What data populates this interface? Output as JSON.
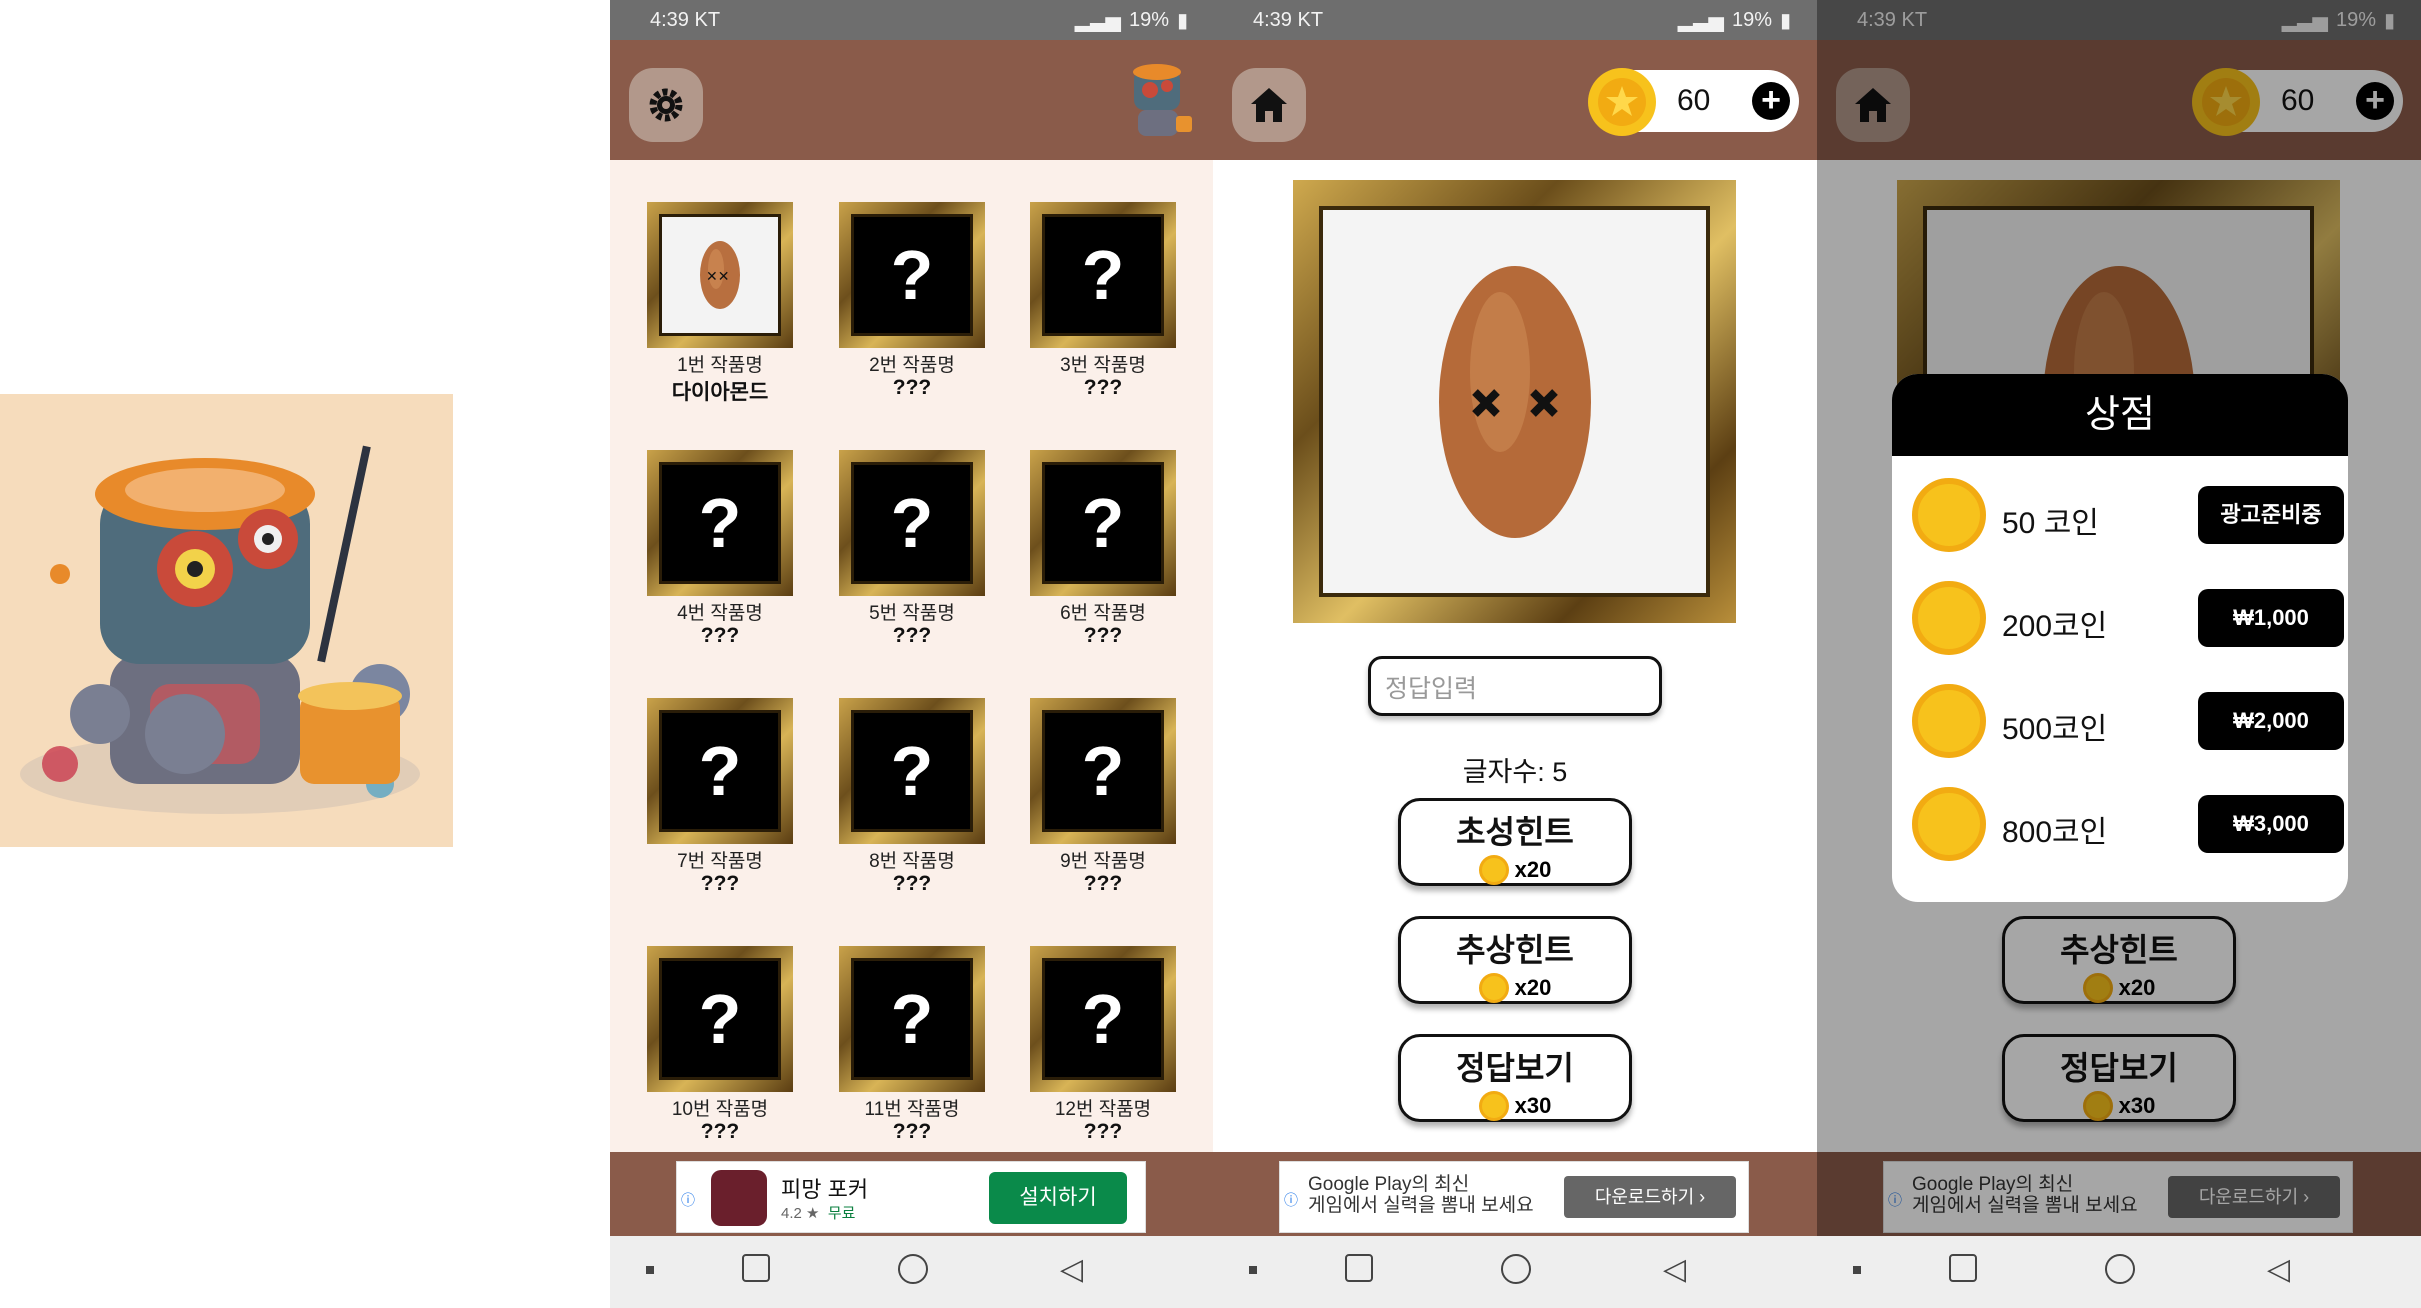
{
  "status": {
    "time": "4:39",
    "carrier": "KT",
    "battery": "19%"
  },
  "gallery": {
    "items": [
      {
        "title": "1번 작품명",
        "name": "다이아몬드",
        "unlocked": true
      },
      {
        "title": "2번 작품명",
        "name": "???"
      },
      {
        "title": "3번 작품명",
        "name": "???"
      },
      {
        "title": "4번 작품명",
        "name": "???"
      },
      {
        "title": "5번 작품명",
        "name": "???"
      },
      {
        "title": "6번 작품명",
        "name": "???"
      },
      {
        "title": "7번 작품명",
        "name": "???"
      },
      {
        "title": "8번 작품명",
        "name": "???"
      },
      {
        "title": "9번 작품명",
        "name": "???"
      },
      {
        "title": "10번 작품명",
        "name": "???"
      },
      {
        "title": "11번 작품명",
        "name": "???"
      },
      {
        "title": "12번 작품명",
        "name": "???"
      }
    ],
    "locked_mark": "?"
  },
  "ad1": {
    "app": "피망 포커",
    "rating": "4.2 ★",
    "price": "무료",
    "cta": "설치하기"
  },
  "quiz": {
    "coins": "60",
    "answer_placeholder": "정답입력",
    "letter_count": "글자수: 5",
    "hints": [
      {
        "label": "초성힌트",
        "cost": "x20"
      },
      {
        "label": "추상힌트",
        "cost": "x20"
      },
      {
        "label": "정답보기",
        "cost": "x30"
      }
    ]
  },
  "ad2": {
    "line1": "Google Play의 최신",
    "line2": "게임에서 실력을 뽐내 보세요",
    "cta": "다운로드하기 ›"
  },
  "shop": {
    "title": "상점",
    "items": [
      {
        "label": "50 코인",
        "price": "광고준비중"
      },
      {
        "label": "200코인",
        "price": "₩1,000"
      },
      {
        "label": "500코인",
        "price": "₩2,000"
      },
      {
        "label": "800코인",
        "price": "₩3,000"
      }
    ]
  },
  "colors": {
    "appbar": "#8a5b4a",
    "gallery_bg": "#fbf0ea",
    "coin": "#f7c21c"
  }
}
